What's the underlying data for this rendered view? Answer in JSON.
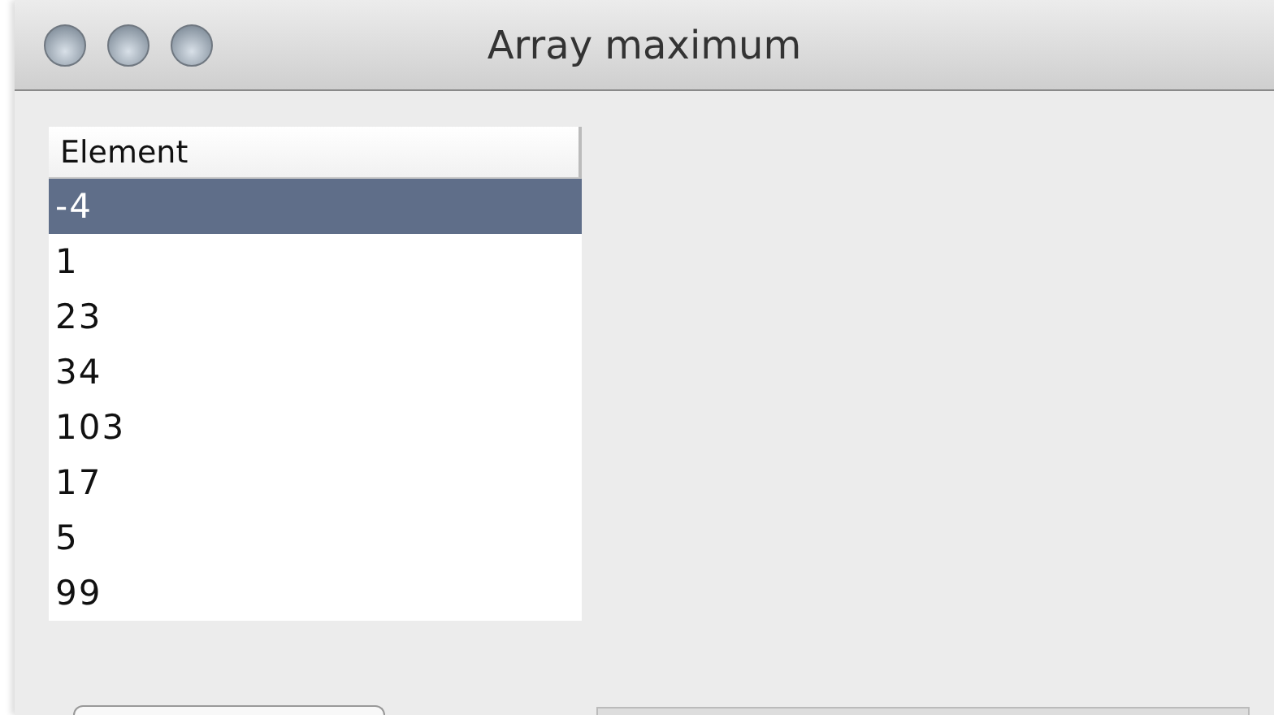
{
  "window": {
    "title": "Array maximum"
  },
  "table": {
    "columns": [
      "Element"
    ],
    "rows": [
      {
        "value": "-4",
        "selected": true
      },
      {
        "value": "1",
        "selected": false
      },
      {
        "value": "23",
        "selected": false
      },
      {
        "value": "34",
        "selected": false
      },
      {
        "value": "103",
        "selected": false
      },
      {
        "value": "17",
        "selected": false
      },
      {
        "value": "5",
        "selected": false
      },
      {
        "value": "99",
        "selected": false
      }
    ]
  }
}
